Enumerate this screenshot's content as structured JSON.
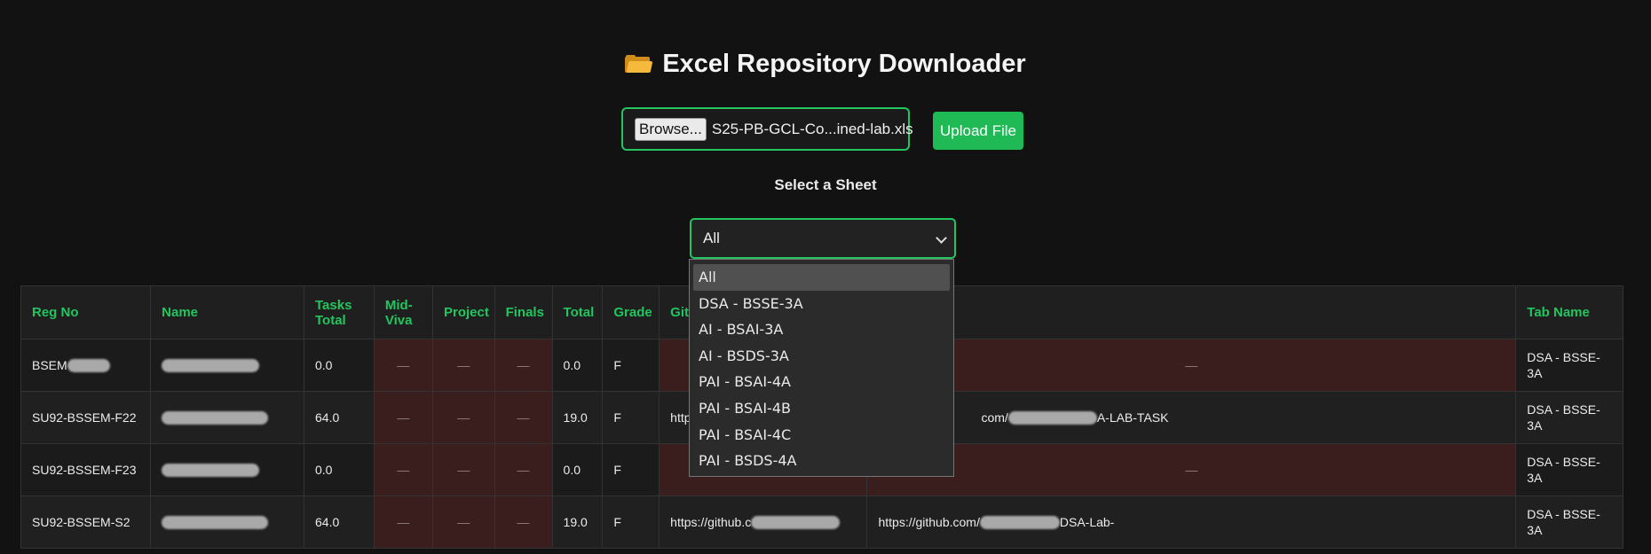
{
  "header": {
    "title": "Excel Repository Downloader",
    "icon": "open-folder-icon"
  },
  "upload": {
    "browse_label": "Browse...",
    "file_name": "S25-PB-GCL-Co...ined-lab.xls",
    "upload_label": "Upload File",
    "accent": "#22c55e"
  },
  "sheet_select": {
    "label": "Select a Sheet",
    "selected": "All",
    "options": [
      "All",
      "DSA - BSSE-3A",
      "AI - BSAI-3A",
      "AI - BSDS-3A",
      "PAI - BSAI-4A",
      "PAI - BSAI-4B",
      "PAI - BSAI-4C",
      "PAI - BSDS-4A"
    ]
  },
  "table": {
    "columns": [
      "Reg No",
      "Name",
      "Tasks Total",
      "Mid-Viva",
      "Project",
      "Finals",
      "Total",
      "Grade",
      "GitH",
      "",
      "Tab Name"
    ],
    "rows": [
      {
        "reg": "BSEM",
        "tasks": "0.0",
        "mid": "—",
        "project": "—",
        "finals": "—",
        "total": "0.0",
        "grade": "F",
        "link1": "",
        "link2": "—",
        "tab": "DSA - BSSE-3A"
      },
      {
        "reg": "SU92-BSSEM-F22",
        "tasks": "64.0",
        "mid": "—",
        "project": "—",
        "finals": "—",
        "total": "19.0",
        "grade": "F",
        "link1": "https",
        "link2": "com/",
        "link2_suffix": "A-LAB-TASK",
        "tab": "DSA - BSSE-3A"
      },
      {
        "reg": "SU92-BSSEM-F23",
        "tasks": "0.0",
        "mid": "—",
        "project": "—",
        "finals": "—",
        "total": "0.0",
        "grade": "F",
        "link1": "",
        "link2": "—",
        "tab": "DSA - BSSE-3A"
      },
      {
        "reg": "SU92-BSSEM-S2",
        "tasks": "64.0",
        "mid": "—",
        "project": "—",
        "finals": "—",
        "total": "19.0",
        "grade": "F",
        "link1": "https://github.c",
        "link2": "https://github.com/",
        "link2_suffix": "DSA-Lab-",
        "tab": "DSA - BSSE-3A"
      }
    ]
  }
}
